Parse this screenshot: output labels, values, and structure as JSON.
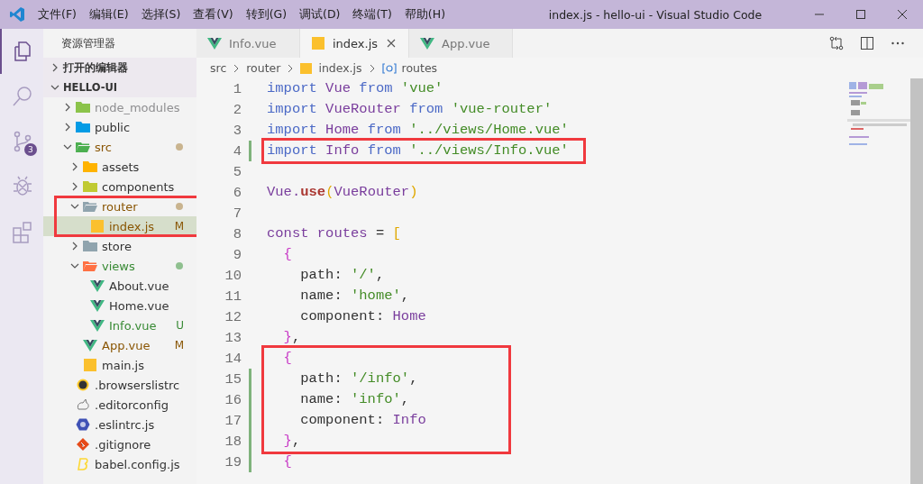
{
  "window": {
    "title": "index.js - hello-ui - Visual Studio Code"
  },
  "menu": [
    "文件(F)",
    "编辑(E)",
    "选择(S)",
    "查看(V)",
    "转到(G)",
    "调试(D)",
    "终端(T)",
    "帮助(H)"
  ],
  "activity_bar": [
    {
      "kind": "files",
      "selected": true
    },
    {
      "kind": "search",
      "selected": false
    },
    {
      "kind": "scm",
      "selected": false,
      "badge": "3"
    },
    {
      "kind": "debug",
      "selected": false
    },
    {
      "kind": "extensions",
      "selected": false
    }
  ],
  "sidebar": {
    "title": "资源管理器",
    "sections": [
      {
        "label": "打开的编辑器",
        "expanded": false
      },
      {
        "label": "HELLO-UI",
        "expanded": true,
        "children": [
          {
            "label": "node_modules",
            "kind": "node",
            "expanded": false,
            "ignored": true,
            "selected": false
          },
          {
            "label": "public",
            "kind": "public",
            "expanded": false,
            "selected": false
          },
          {
            "label": "src",
            "kind": "src",
            "expanded": true,
            "modified": true,
            "dot": true,
            "selected": false,
            "children": [
              {
                "label": "assets",
                "kind": "assets",
                "expanded": false,
                "selected": false
              },
              {
                "label": "components",
                "kind": "components",
                "expanded": false,
                "selected": false
              },
              {
                "label": "router",
                "kind": "router",
                "expanded": true,
                "modified": true,
                "dot": true,
                "boxed": true,
                "selected": false,
                "children": [
                  {
                    "label": "index.js",
                    "kind": "js",
                    "modified": true,
                    "badge": "M",
                    "boxed": true,
                    "selected": true
                  }
                ]
              },
              {
                "label": "store",
                "kind": "store",
                "expanded": false,
                "selected": false
              },
              {
                "label": "views",
                "kind": "views",
                "expanded": true,
                "untracked": true,
                "dot": true,
                "selected": false,
                "children": [
                  {
                    "label": "About.vue",
                    "kind": "vue",
                    "selected": false
                  },
                  {
                    "label": "Home.vue",
                    "kind": "vue",
                    "selected": false
                  },
                  {
                    "label": "Info.vue",
                    "kind": "vue",
                    "untracked": true,
                    "badge": "U",
                    "selected": false
                  }
                ]
              },
              {
                "label": "App.vue",
                "kind": "vue",
                "modified": true,
                "badge": "M",
                "selected": false
              },
              {
                "label": "main.js",
                "kind": "js",
                "selected": false
              }
            ]
          },
          {
            "label": ".browserslistrc",
            "kind": "browserslist",
            "selected": false
          },
          {
            "label": ".editorconfig",
            "kind": "editorconfig",
            "selected": false
          },
          {
            "label": ".eslintrc.js",
            "kind": "eslint",
            "selected": false
          },
          {
            "label": ".gitignore",
            "kind": "git",
            "selected": false
          },
          {
            "label": "babel.config.js",
            "kind": "babel",
            "selected": false
          }
        ]
      }
    ]
  },
  "tabs": [
    {
      "label": "Info.vue",
      "kind": "vue",
      "selected": false
    },
    {
      "label": "index.js",
      "kind": "js",
      "selected": true
    },
    {
      "label": "App.vue",
      "kind": "vue",
      "selected": false
    }
  ],
  "breadcrumbs": [
    {
      "label": "src",
      "kind": "folder"
    },
    {
      "label": "router",
      "kind": "folder"
    },
    {
      "label": "index.js",
      "kind": "js"
    },
    {
      "label": "routes",
      "kind": "symbol"
    }
  ],
  "code": [
    {
      "number": "1",
      "modified": false,
      "tokens": [
        {
          "kind": "keyword",
          "text": "import"
        },
        {
          "kind": "ident",
          "text": " Vue "
        },
        {
          "kind": "keyword",
          "text": "from"
        },
        {
          "kind": "string",
          "text": " 'vue'"
        }
      ]
    },
    {
      "number": "2",
      "modified": false,
      "tokens": [
        {
          "kind": "keyword",
          "text": "import"
        },
        {
          "kind": "ident",
          "text": " VueRouter "
        },
        {
          "kind": "keyword",
          "text": "from"
        },
        {
          "kind": "string",
          "text": " 'vue-router'"
        }
      ]
    },
    {
      "number": "3",
      "modified": false,
      "tokens": [
        {
          "kind": "keyword",
          "text": "import"
        },
        {
          "kind": "ident",
          "text": " Home "
        },
        {
          "kind": "keyword",
          "text": "from"
        },
        {
          "kind": "string",
          "text": " '../views/Home.vue'"
        }
      ]
    },
    {
      "number": "4",
      "modified": true,
      "boxed": true,
      "tokens": [
        {
          "kind": "keyword",
          "text": "import"
        },
        {
          "kind": "ident",
          "text": " Info "
        },
        {
          "kind": "keyword",
          "text": "from"
        },
        {
          "kind": "string",
          "text": " '../views/Info.vue'"
        }
      ]
    },
    {
      "number": "5",
      "modified": false
    },
    {
      "number": "6",
      "modified": false,
      "tokens": [
        {
          "kind": "ident",
          "text": "Vue."
        },
        {
          "kind": "method",
          "text": "use"
        },
        {
          "kind": "bracket1",
          "text": "("
        },
        {
          "kind": "ident",
          "text": "VueRouter"
        },
        {
          "kind": "bracket1",
          "text": ")"
        }
      ]
    },
    {
      "number": "7",
      "modified": false
    },
    {
      "number": "8",
      "modified": false,
      "tokens": [
        {
          "kind": "ident",
          "text": "const routes "
        },
        {
          "kind": "plain",
          "text": "= "
        },
        {
          "kind": "bracket1",
          "text": "["
        }
      ]
    },
    {
      "number": "9",
      "modified": false,
      "tokens": [
        {
          "kind": "bracket2",
          "text": "  {"
        }
      ]
    },
    {
      "number": "10",
      "modified": false,
      "tokens": [
        {
          "kind": "plain",
          "text": "    path: "
        },
        {
          "kind": "string",
          "text": "'/'"
        },
        {
          "kind": "plain",
          "text": ","
        }
      ]
    },
    {
      "number": "11",
      "modified": false,
      "tokens": [
        {
          "kind": "plain",
          "text": "    name: "
        },
        {
          "kind": "string",
          "text": "'home'"
        },
        {
          "kind": "plain",
          "text": ","
        }
      ]
    },
    {
      "number": "12",
      "modified": false,
      "tokens": [
        {
          "kind": "plain",
          "text": "    component: "
        },
        {
          "kind": "ident",
          "text": "Home"
        }
      ]
    },
    {
      "number": "13",
      "modified": false,
      "tokens": [
        {
          "kind": "bracket2",
          "text": "  }"
        },
        {
          "kind": "plain",
          "text": ","
        }
      ]
    },
    {
      "number": "14",
      "modified": false,
      "boxed": true,
      "tokens": [
        {
          "kind": "bracket2",
          "text": "  {"
        }
      ]
    },
    {
      "number": "15",
      "modified": true,
      "boxed": true,
      "tokens": [
        {
          "kind": "plain",
          "text": "    path: "
        },
        {
          "kind": "string",
          "text": "'/info'"
        },
        {
          "kind": "plain",
          "text": ","
        }
      ]
    },
    {
      "number": "16",
      "modified": true,
      "boxed": true,
      "tokens": [
        {
          "kind": "plain",
          "text": "    name: "
        },
        {
          "kind": "string",
          "text": "'info'"
        },
        {
          "kind": "plain",
          "text": ","
        }
      ]
    },
    {
      "number": "17",
      "modified": true,
      "boxed": true,
      "tokens": [
        {
          "kind": "plain",
          "text": "    component: "
        },
        {
          "kind": "ident",
          "text": "Info"
        }
      ]
    },
    {
      "number": "18",
      "modified": true,
      "boxed": true,
      "tokens": [
        {
          "kind": "bracket2",
          "text": "  }"
        },
        {
          "kind": "plain",
          "text": ","
        }
      ]
    },
    {
      "number": "19",
      "modified": true,
      "tokens": [
        {
          "kind": "bracket2",
          "text": "  {"
        }
      ]
    }
  ]
}
